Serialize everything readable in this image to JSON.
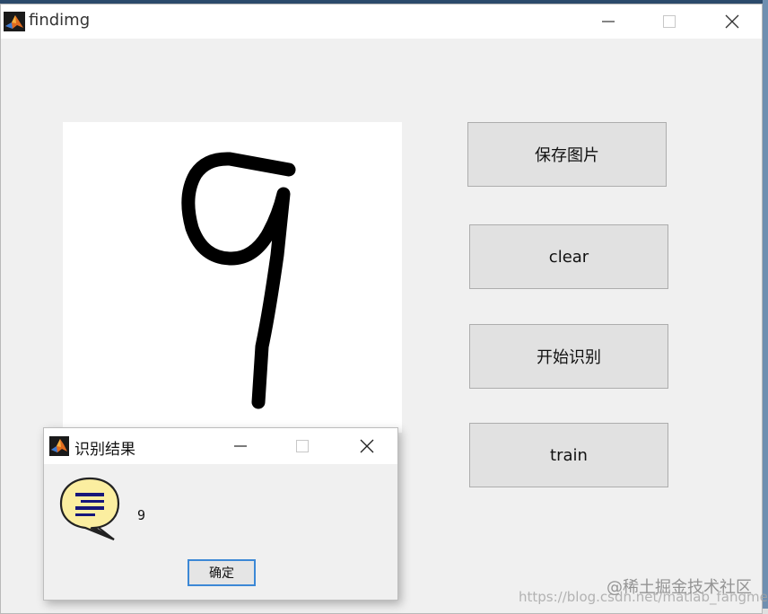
{
  "window": {
    "title": "findimg"
  },
  "buttons": {
    "save_image": "保存图片",
    "clear": "clear",
    "start_recognition": "开始识别",
    "train": "train"
  },
  "dialog": {
    "title": "识别结果",
    "message": "9",
    "ok_label": "确定"
  },
  "watermark": {
    "site": "@稀土掘金技术社区",
    "url": "https://blog.csdn.net/matlab_fangmen"
  },
  "colors": {
    "window_bg": "#f0f0f0",
    "button_bg": "#e1e1e1",
    "ok_border": "#3c88d6",
    "icon_bubble": "#fbeea0"
  }
}
